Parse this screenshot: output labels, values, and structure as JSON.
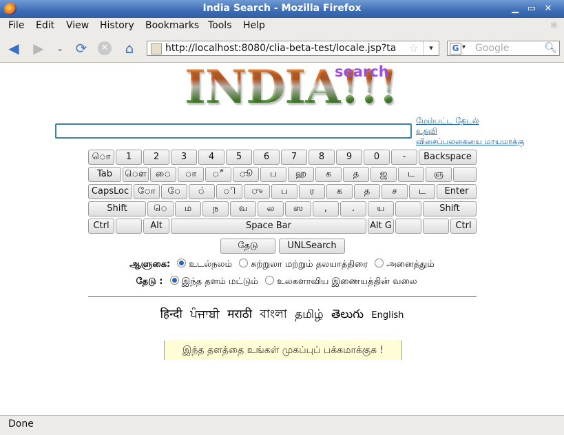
{
  "window": {
    "title": "India Search - Mozilla Firefox"
  },
  "menu": [
    "File",
    "Edit",
    "View",
    "History",
    "Bookmarks",
    "Tools",
    "Help"
  ],
  "toolbar": {
    "url": "http://localhost:8080/clia-beta-test/locale.jsp?ta",
    "search_placeholder": "Google",
    "search_engine_letter": "G"
  },
  "logo": {
    "main": "INDIA!!!",
    "sub": "search"
  },
  "side_links": [
    "மேம்பட்ட தேடல்",
    "உதவி",
    "விசைப்பலகையை மாயமாக்கு"
  ],
  "keyboard": {
    "rows": [
      [
        "ொ",
        "1",
        "2",
        "3",
        "4",
        "5",
        "6",
        "7",
        "8",
        "9",
        "0",
        "-",
        "Backspace"
      ],
      [
        "Tab",
        "ௌ",
        "ை",
        "ா",
        "ீ",
        "ூ",
        "ப",
        "ஹ",
        "க",
        "த",
        "ஜ",
        "ட",
        "ஞ",
        ""
      ],
      [
        "CapsLoc",
        "ோ",
        "ே",
        "்",
        "ி",
        "ு",
        "ப",
        "ர",
        "க",
        "த",
        "ச",
        "ட",
        "Enter"
      ],
      [
        "Shift",
        "ெ",
        "ம",
        "ந",
        "வ",
        "ல",
        "ஸ",
        ",",
        ".",
        "ய",
        "",
        "Shift"
      ],
      [
        "Ctrl",
        "",
        "Alt",
        "Space Bar",
        "Alt G",
        "",
        "",
        "Ctrl"
      ]
    ]
  },
  "buttons": {
    "search": "தேடு",
    "unl": "UNLSearch"
  },
  "options": {
    "row1_label": "ஆளுகை:",
    "row1": [
      "உடல்நலம்",
      "சுற்றுலா மற்றும் தலயாத்திரை",
      "அனைத்தும்"
    ],
    "row2_label": "தேடு :",
    "row2": [
      "இந்த தளம் மட்டும்",
      "உலகளாவிய இணையத்தின் வலை"
    ]
  },
  "languages": [
    "हिन्दी",
    "ਪੰਜਾਬੀ",
    "मराठी",
    "বাংলা",
    "தமிழ்",
    "తెలుగు",
    "English"
  ],
  "make_home": "இந்த தளத்தை உங்கள் முகப்புப் பக்கமாக்குக !",
  "status": "Done"
}
